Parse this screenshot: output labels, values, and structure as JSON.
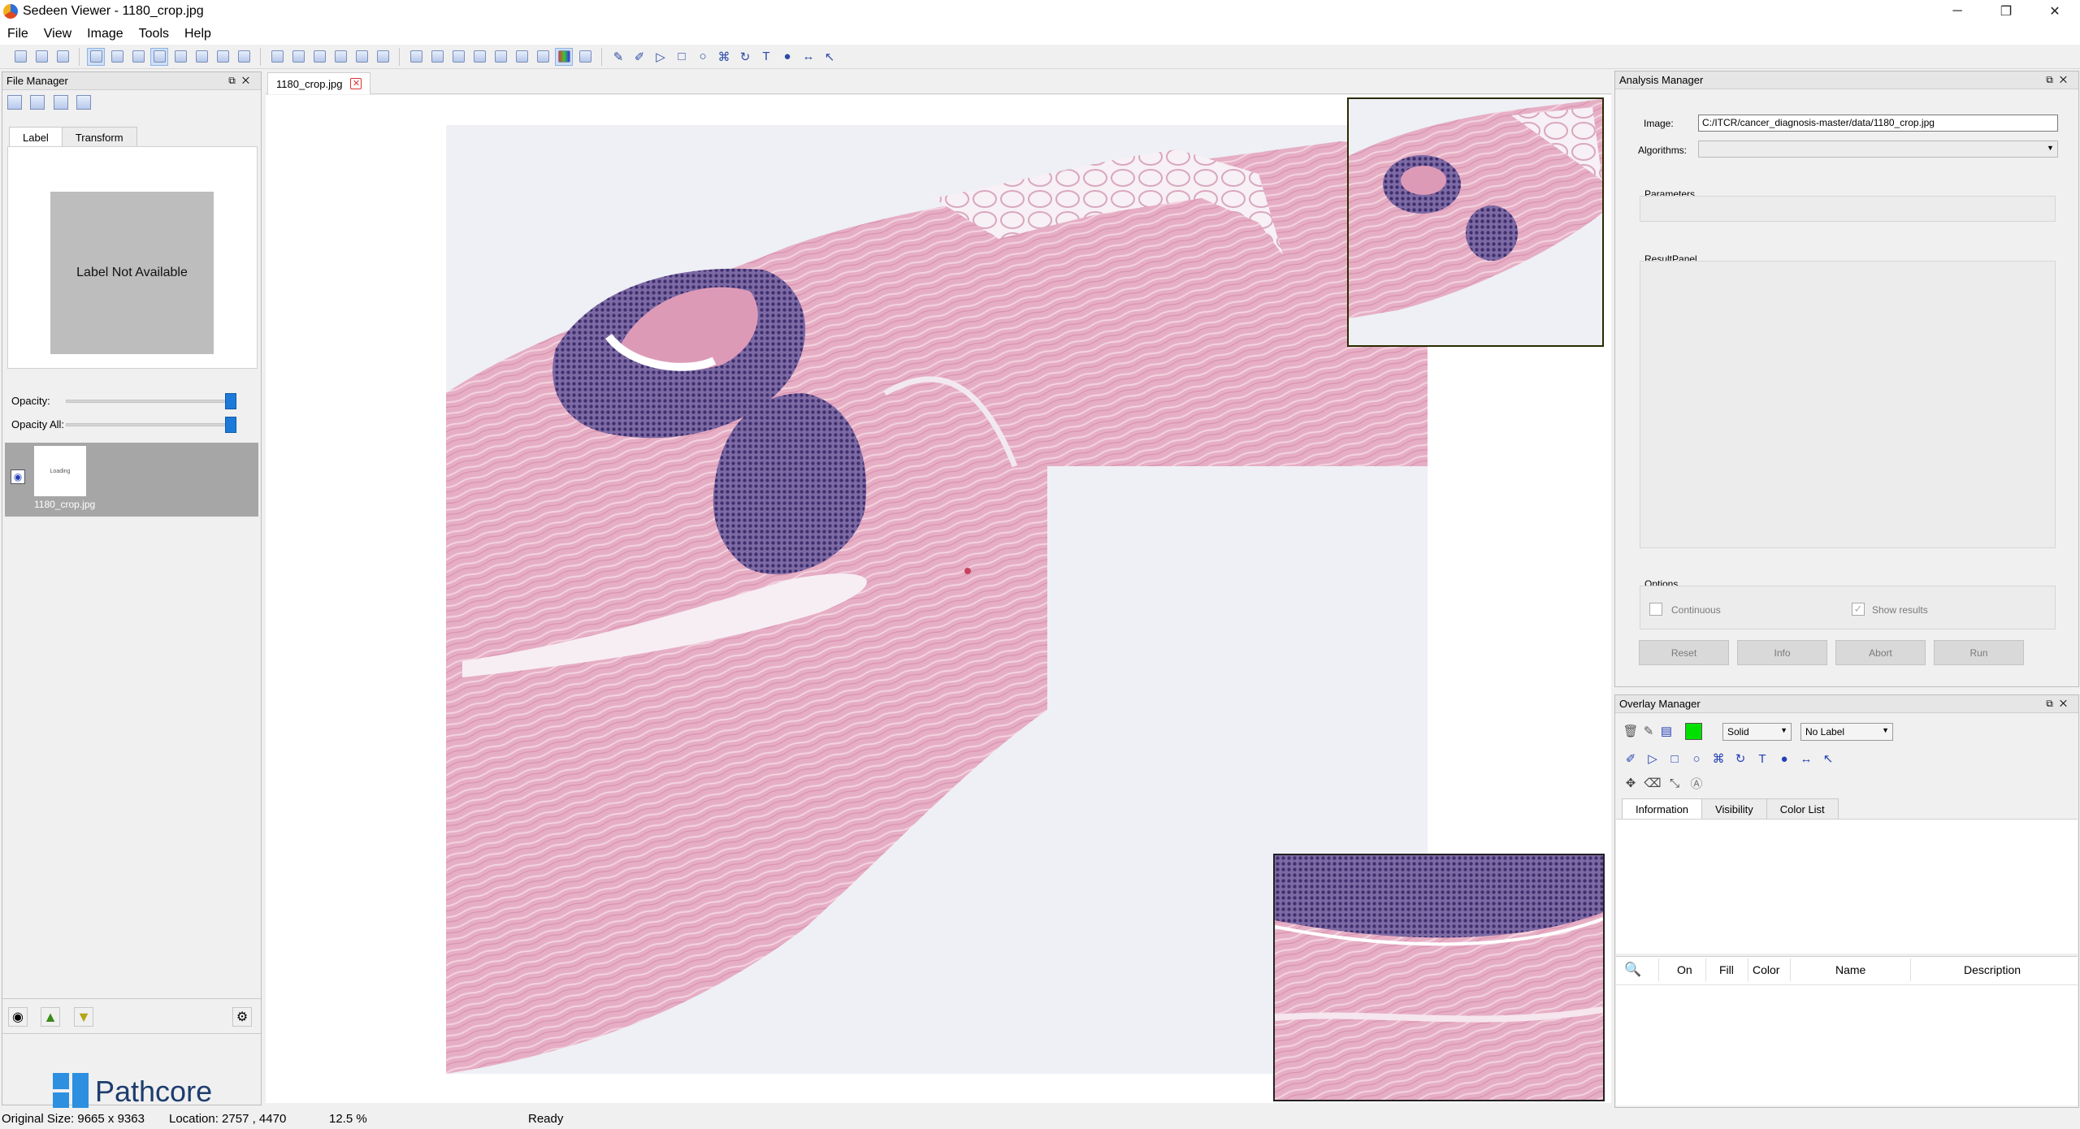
{
  "window": {
    "title": "Sedeen Viewer - 1180_crop.jpg",
    "minimize": "─",
    "maximize": "❐",
    "close": "✕"
  },
  "menu": [
    "File",
    "View",
    "Image",
    "Tools",
    "Help"
  ],
  "file_manager": {
    "title": "File Manager",
    "tabs": [
      "Label",
      "Transform"
    ],
    "label_placeholder": "Label Not Available",
    "opacity_label": "Opacity:",
    "opacity_all_label": "Opacity All:",
    "opacity": 1.0,
    "opacity_all": 1.0,
    "thumbnail_name": "1180_crop.jpg",
    "thumbnail_caption": "Loading",
    "logo_text": "Pathcore"
  },
  "document": {
    "tab_label": "1180_crop.jpg"
  },
  "analysis_manager": {
    "title": "Analysis Manager",
    "image_label": "Image:",
    "image_path": "C:/ITCR/cancer_diagnosis-master/data/1180_crop.jpg",
    "algorithms_label": "Algorithms:",
    "algorithms_value": "",
    "parameters_label": "Parameters",
    "result_panel_label": "ResultPanel",
    "options_label": "Options",
    "continuous_label": "Continuous",
    "show_results_label": "Show results",
    "show_results_checked": true,
    "continuous_checked": false,
    "buttons": {
      "reset": "Reset",
      "info": "Info",
      "abort": "Abort",
      "run": "Run"
    }
  },
  "overlay_manager": {
    "title": "Overlay Manager",
    "color": "#00e000",
    "line_style": "Solid",
    "label_select": "No Label",
    "tabs": [
      "Information",
      "Visibility",
      "Color List"
    ],
    "columns": [
      "On",
      "Fill",
      "Color",
      "Name",
      "Description"
    ]
  },
  "status": {
    "original_size": "Original Size: 9665 x 9363",
    "location": "Location: 2757 , 4470",
    "zoom": "12.5 %",
    "state": "Ready"
  },
  "colors": {
    "accent": "#1e7ad8",
    "tissue": "#e7b0c4",
    "nuclei": "#5c4a86",
    "brand": "#2d8fe0"
  }
}
